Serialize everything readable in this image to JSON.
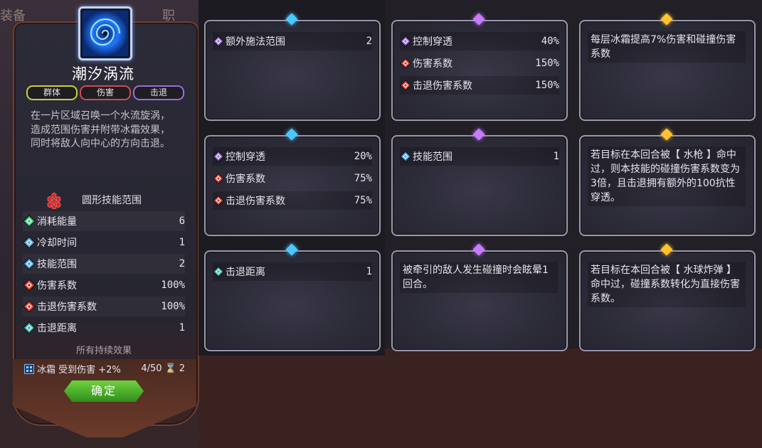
{
  "left": {
    "tab_left": "装备",
    "tab_right": "职",
    "skill_title": "潮汐涡流",
    "tags": [
      "群体",
      "伤害",
      "击退"
    ],
    "description": "在一片区域召唤一个水流旋涡，造成范围伤害并附带冰霜效果，同时将敌人向中心的方向击退。",
    "range_label": "圆形技能范围",
    "stats": [
      {
        "label": "消耗能量",
        "value": "6",
        "icon": "energy-icon",
        "color": "#3ed07a"
      },
      {
        "label": "冷却时间",
        "value": "1",
        "icon": "cooldown-icon",
        "color": "#59a8d8"
      },
      {
        "label": "技能范围",
        "value": "2",
        "icon": "range-icon",
        "color": "#4aa6e8"
      },
      {
        "label": "伤害系数",
        "value": "100%",
        "icon": "damage-icon",
        "color": "#d8422f"
      },
      {
        "label": "击退伤害系数",
        "value": "100%",
        "icon": "knockback-damage-icon",
        "color": "#d8422f"
      },
      {
        "label": "击退距离",
        "value": "1",
        "icon": "knockback-distance-icon",
        "color": "#3fb5b0"
      }
    ],
    "effects_title": "所有持续效果",
    "effect": {
      "name": "冰霜 受到伤害 +2%",
      "progress": "4/50",
      "turns": "2"
    },
    "confirm": "确定"
  },
  "cards": [
    {
      "gem": "blue",
      "rows": [
        {
          "label": "额外施法范围",
          "value": "2",
          "icon": "extra-range-icon",
          "color": "#9a6cd8"
        }
      ]
    },
    {
      "gem": "purple",
      "rows": [
        {
          "label": "控制穿透",
          "value": "40%",
          "icon": "control-pierce-icon",
          "color": "#9a6cd8"
        },
        {
          "label": "伤害系数",
          "value": "150%",
          "icon": "damage-icon",
          "color": "#d8422f"
        },
        {
          "label": "击退伤害系数",
          "value": "150%",
          "icon": "knockback-damage-icon",
          "color": "#d8422f"
        }
      ]
    },
    {
      "gem": "gold",
      "text": "每层冰霜提高7%伤害和碰撞伤害系数"
    },
    {
      "gem": "blue",
      "rows": [
        {
          "label": "控制穿透",
          "value": "20%",
          "icon": "control-pierce-icon",
          "color": "#9a6cd8"
        },
        {
          "label": "伤害系数",
          "value": "75%",
          "icon": "damage-icon",
          "color": "#d8422f"
        },
        {
          "label": "击退伤害系数",
          "value": "75%",
          "icon": "knockback-damage-icon",
          "color": "#d8422f"
        }
      ]
    },
    {
      "gem": "purple",
      "rows": [
        {
          "label": "技能范围",
          "value": "1",
          "icon": "range-icon",
          "color": "#4aa6e8"
        }
      ]
    },
    {
      "gem": "gold",
      "text": "若目标在本回合被【 水枪 】命中过，则本技能的碰撞伤害系数变为3倍，且击退拥有额外的100抗性穿透。"
    },
    {
      "gem": "blue",
      "rows": [
        {
          "label": "击退距离",
          "value": "1",
          "icon": "knockback-distance-icon",
          "color": "#3fb5b0"
        }
      ]
    },
    {
      "gem": "purple",
      "text": "被牵引的敌人发生碰撞时会眩晕1回合。"
    },
    {
      "gem": "gold",
      "text": "若目标在本回合被【 水球炸弹 】命中过，碰撞系数转化为直接伤害系数。"
    }
  ]
}
